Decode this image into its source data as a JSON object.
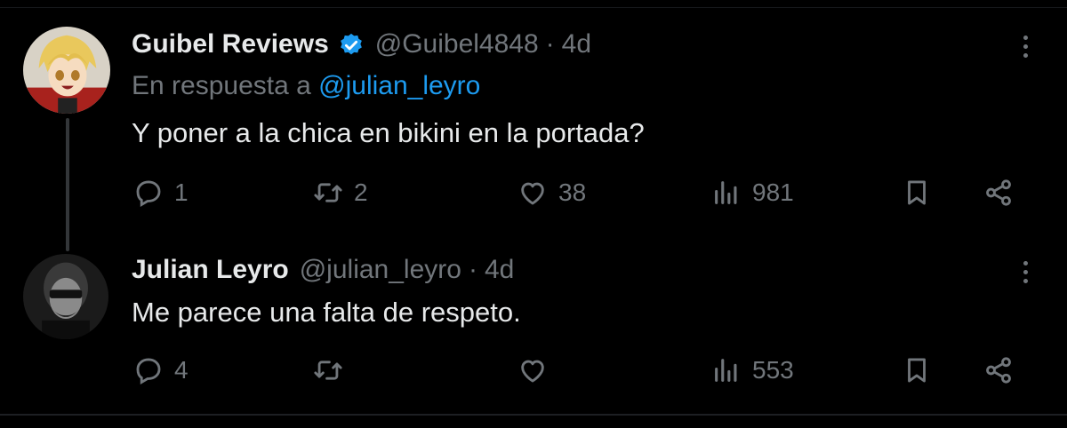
{
  "tweets": [
    {
      "author_name": "Guibel Reviews",
      "verified": true,
      "handle": "@Guibel4848",
      "separator": "·",
      "time": "4d",
      "reply_prefix": "En respuesta a",
      "reply_mention": "@julian_leyro",
      "text": "Y poner a la chica en bikini en la portada?",
      "replies": "1",
      "retweets": "2",
      "likes": "38",
      "views": "981"
    },
    {
      "author_name": "Julian Leyro",
      "verified": false,
      "handle": "@julian_leyro",
      "separator": "·",
      "time": "4d",
      "text": "Me parece una falta de respeto.",
      "replies": "4",
      "retweets": "",
      "likes": "",
      "views": "553"
    }
  ],
  "colors": {
    "background": "#000000",
    "primary_text": "#e7e9ea",
    "secondary_text": "#71767b",
    "accent": "#1d9bf0",
    "divider": "#2f3336"
  },
  "icons": [
    "verified-badge-icon",
    "reply-icon",
    "retweet-icon",
    "like-icon",
    "views-icon",
    "bookmark-icon",
    "share-icon",
    "more-icon"
  ]
}
